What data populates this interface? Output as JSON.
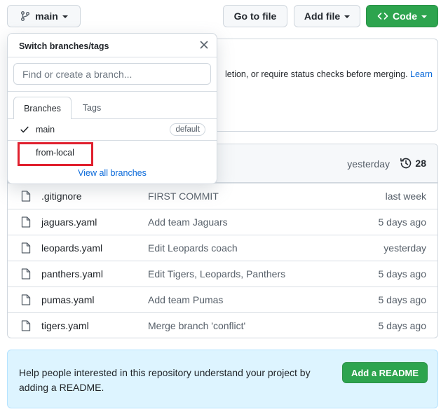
{
  "toolbar": {
    "branch_label": "main",
    "goto_file": "Go to file",
    "add_file": "Add file",
    "code": "Code"
  },
  "protection": {
    "text": "letion, or require status checks before merging.",
    "link": "Learn"
  },
  "file_list": {
    "latest_time": "yesterday",
    "commit_count": "28",
    "files": [
      {
        "name": ".gitignore",
        "message": "FIRST COMMIT",
        "date": "last week"
      },
      {
        "name": "jaguars.yaml",
        "message": "Add team Jaguars",
        "date": "5 days ago"
      },
      {
        "name": "leopards.yaml",
        "message": "Edit Leopards coach",
        "date": "yesterday"
      },
      {
        "name": "panthers.yaml",
        "message": "Edit Tigers, Leopards, Panthers",
        "date": "5 days ago"
      },
      {
        "name": "pumas.yaml",
        "message": "Add team Pumas",
        "date": "5 days ago"
      },
      {
        "name": "tigers.yaml",
        "message": "Merge branch 'conflict'",
        "date": "5 days ago"
      }
    ]
  },
  "readme": {
    "text": "Help people interested in this repository understand your project by adding a README.",
    "button": "Add a README"
  },
  "dropdown": {
    "title": "Switch branches/tags",
    "search_placeholder": "Find or create a branch...",
    "tabs": [
      "Branches",
      "Tags"
    ],
    "branches": [
      {
        "name": "main",
        "badge": "default",
        "selected": true
      },
      {
        "name": "from-local",
        "badge": "",
        "selected": false
      }
    ],
    "view_all": "View all branches"
  },
  "colors": {
    "accent_green": "#2da44e",
    "link_blue": "#0969da",
    "highlight_red": "#e0202e",
    "readme_bg": "#ddf4ff"
  }
}
